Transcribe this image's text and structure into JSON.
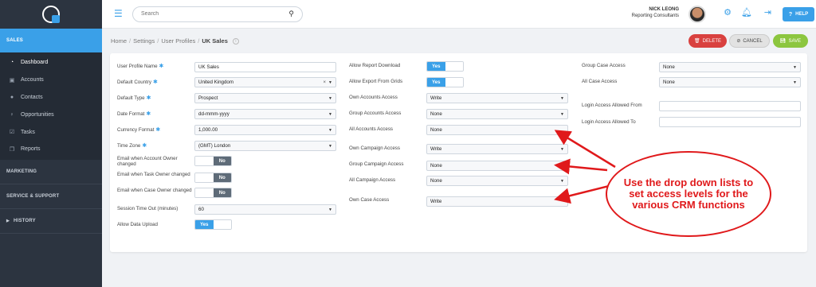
{
  "sidebar": {
    "sections": {
      "sales": "SALES",
      "marketing": "MARKETING",
      "service": "SERVICE & SUPPORT",
      "history": "HISTORY"
    },
    "items": [
      {
        "label": "Dashboard",
        "icon": "dashboard-icon"
      },
      {
        "label": "Accounts",
        "icon": "briefcase-icon"
      },
      {
        "label": "Contacts",
        "icon": "users-icon"
      },
      {
        "label": "Opportunities",
        "icon": "lightbulb-icon"
      },
      {
        "label": "Tasks",
        "icon": "check-square-icon"
      },
      {
        "label": "Reports",
        "icon": "copy-icon"
      }
    ]
  },
  "topbar": {
    "search_placeholder": "Search",
    "user_name": "NICK LEONG",
    "user_role": "Reporting Consultants",
    "help_label": "HELP"
  },
  "breadcrumb": {
    "home": "Home",
    "settings": "Settings",
    "user_profiles": "User Profiles",
    "current": "UK Sales"
  },
  "actions": {
    "delete": "DELETE",
    "cancel": "CANCEL",
    "save": "SAVE"
  },
  "form": {
    "col1": {
      "profile_name": {
        "label": "User Profile Name",
        "value": "UK Sales"
      },
      "country": {
        "label": "Default Country",
        "value": "United Kingdom"
      },
      "type": {
        "label": "Default Type",
        "value": "Prospect"
      },
      "date_format": {
        "label": "Date Format",
        "value": "dd-mmm-yyyy"
      },
      "currency": {
        "label": "Currency Format",
        "value": "1,000.00"
      },
      "timezone": {
        "label": "Time Zone",
        "value": "(GMT) London"
      },
      "email_account": {
        "label": "Email when Account Owner changed",
        "value": "No"
      },
      "email_task": {
        "label": "Email when Task Owner changed",
        "value": "No"
      },
      "email_case": {
        "label": "Email when Case Owner changed",
        "value": "No"
      },
      "session_timeout": {
        "label": "Session Time Out (minutes)",
        "value": "60"
      },
      "allow_upload": {
        "label": "Allow Data Upload",
        "value": "Yes"
      }
    },
    "col2": {
      "report_download": {
        "label": "Allow Report Download",
        "value": "Yes"
      },
      "export_grids": {
        "label": "Allow Export From Grids",
        "value": "Yes"
      },
      "own_accounts": {
        "label": "Own Accounts Access",
        "value": "Write"
      },
      "group_accounts": {
        "label": "Group Accounts Access",
        "value": "None"
      },
      "all_accounts": {
        "label": "All Accounts Access",
        "value": "None"
      },
      "own_campaign": {
        "label": "Own Campaign Access",
        "value": "Write"
      },
      "group_campaign": {
        "label": "Group Campaign Access",
        "value": "None"
      },
      "all_campaign": {
        "label": "All Campaign Access",
        "value": "None"
      },
      "own_case": {
        "label": "Own Case Access",
        "value": "Write"
      }
    },
    "col3": {
      "group_case": {
        "label": "Group Case Access",
        "value": "None"
      },
      "all_case": {
        "label": "All Case Access",
        "value": "None"
      },
      "login_from": {
        "label": "Login Access Allowed From",
        "value": ""
      },
      "login_to": {
        "label": "Login Access Allowed To",
        "value": ""
      }
    }
  },
  "annotation": {
    "text": "Use the drop down lists to set access levels for the various CRM functions"
  },
  "colors": {
    "accent": "#3aa0e8",
    "sidebar": "#2c3440",
    "delete": "#d9413f",
    "save": "#8cc63f",
    "annotation": "#e0191b"
  }
}
